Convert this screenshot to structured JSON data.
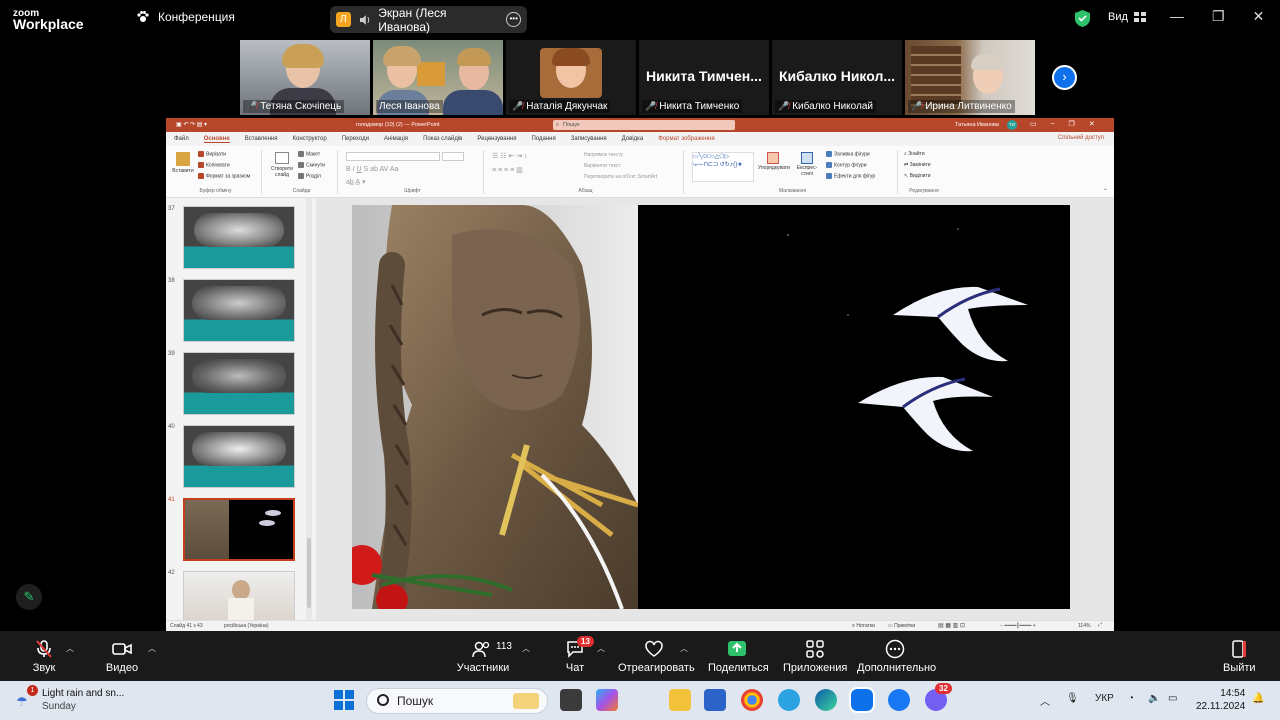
{
  "zoom": {
    "logo_line1": "zoom",
    "logo_line2": "Workplace",
    "conference_label": "Конференция",
    "share_label": "Экран (Леся Иванова)",
    "share_avatar": "Л",
    "view_label": "Вид"
  },
  "participants": [
    {
      "name": "Тетяна Скочіпець",
      "muted": true
    },
    {
      "name": "Леся Іванова",
      "muted": false,
      "active": true
    },
    {
      "name": "Наталія Дякунчак",
      "muted": true
    },
    {
      "name": "Никита Тимченко",
      "display": "Никита Тимчен...",
      "muted": true
    },
    {
      "name": "Кибалко Николай",
      "display": "Кибалко Никол...",
      "muted": true
    },
    {
      "name": "Ирина Литвиненко",
      "muted": true
    }
  ],
  "ppt": {
    "filename": "голодомор (10) (2) — PowerPoint",
    "search_placeholder": "Пошук",
    "user": "Татьяна Иванова",
    "user_initials": "ТИ",
    "menu": [
      "Файл",
      "Основне",
      "Вставлення",
      "Конструктор",
      "Переходи",
      "Анімація",
      "Показ слайдів",
      "Рецензування",
      "Подання",
      "Записування",
      "Довідка",
      "Формат зображення"
    ],
    "share_button": "Спільний доступ",
    "ribbon": {
      "paste": "Вставити",
      "cut": "Вирізати",
      "copy": "Копіювати",
      "format_painter": "Формат за зразком",
      "clipboard_group": "Буфер обміну",
      "new_slide": "Створити слайд",
      "layout": "Макет",
      "reset": "Скинути",
      "section": "Розділ",
      "slides_group": "Слайди",
      "font_group": "Шрифт",
      "paragraph_group": "Абзац",
      "text_direction": "Напрямок тексту",
      "align_text": "Вирівняти текст",
      "smartart": "Перетворити на об'єкт SmartArt",
      "arrange": "Упорядкувати",
      "quick_styles": "Експрес-стилі",
      "shape_fill": "Заливка фігури",
      "shape_outline": "Контур фігури",
      "shape_effects": "Ефекти для фігур",
      "drawing_group": "Малювання",
      "find": "Знайти",
      "replace": "Замінити",
      "select": "Виділити",
      "editing_group": "Редагування"
    },
    "slides": [
      {
        "num": "37",
        "selected": false
      },
      {
        "num": "38",
        "selected": false
      },
      {
        "num": "39",
        "selected": false
      },
      {
        "num": "40",
        "selected": false
      },
      {
        "num": "41",
        "selected": true
      },
      {
        "num": "42",
        "selected": false
      }
    ],
    "status_slide": "Слайд 41 з 43",
    "status_lang": "російська (Україна)",
    "status_notes": "Нотатки",
    "status_comments": "Примітки",
    "zoom_level": "114%"
  },
  "toolbar": {
    "audio": "Звук",
    "video": "Видео",
    "participants": "Участники",
    "participants_count": "113",
    "chat": "Чат",
    "chat_badge": "13",
    "react": "Отреагировать",
    "share": "Поделиться",
    "apps": "Приложения",
    "more": "Дополнительно",
    "leave": "Выйти"
  },
  "taskbar": {
    "weather_title": "Light rain and sn...",
    "weather_sub": "Sunday",
    "weather_badge": "1",
    "search": "Пошук",
    "lang": "УКР",
    "time": "14:54",
    "date": "22.11.2024",
    "viber_badge": "32"
  },
  "colors": {
    "zoom_blue": "#0e71eb",
    "active_speaker": "#2dc26b",
    "ppt_red": "#b7472a",
    "muted_red": "#e23b3b"
  }
}
